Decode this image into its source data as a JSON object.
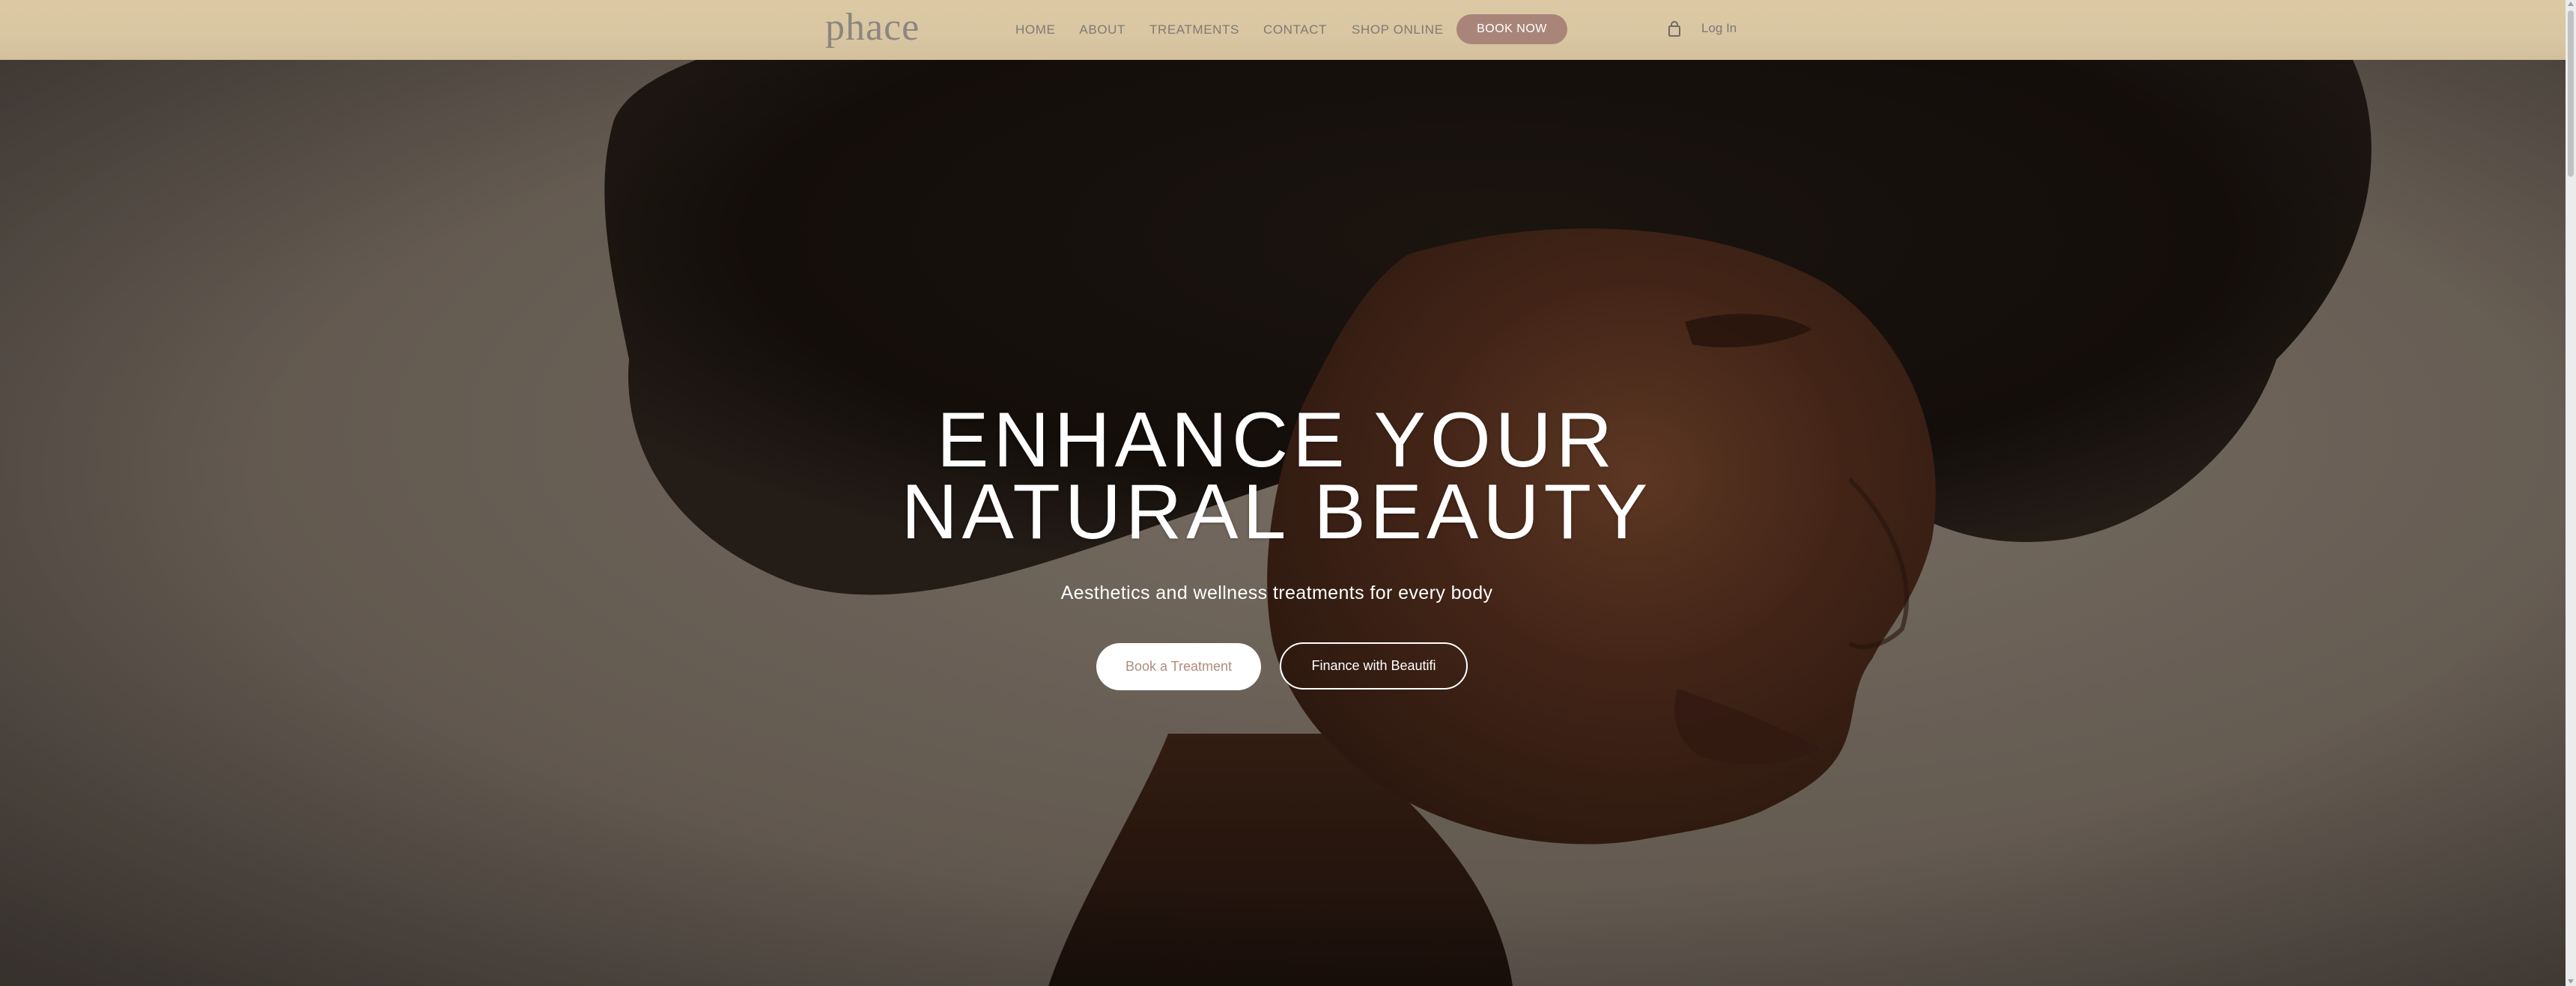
{
  "header": {
    "logo_text": "phace",
    "nav": {
      "home": "HOME",
      "about": "ABOUT",
      "treatments": "TREATMENTS",
      "contact": "CONTACT",
      "shop": "SHOP ONLINE"
    },
    "book_now_label": "BOOK NOW",
    "cart_icon": "shopping-bag-icon",
    "login_label": "Log In"
  },
  "hero": {
    "headline_line1": "ENHANCE YOUR",
    "headline_line2": "NATURAL BEAUTY",
    "subheadline": "Aesthetics and wellness treatments for every body",
    "primary_cta": "Book a Treatment",
    "secondary_cta": "Finance with Beautifi"
  },
  "colors": {
    "header_bg": "#dac7a3",
    "book_now_bg": "#a98579",
    "nav_text": "#7f7a73",
    "primary_cta_text": "#b08c80",
    "hero_text": "#ffffff"
  }
}
